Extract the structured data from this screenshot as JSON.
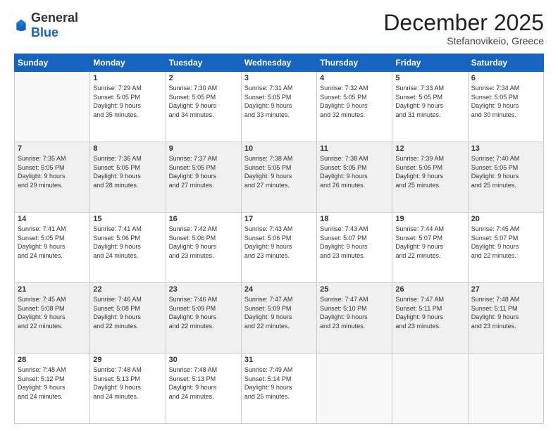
{
  "header": {
    "logo_general": "General",
    "logo_blue": "Blue",
    "month": "December 2025",
    "location": "Stefanovikeio, Greece"
  },
  "days_of_week": [
    "Sunday",
    "Monday",
    "Tuesday",
    "Wednesday",
    "Thursday",
    "Friday",
    "Saturday"
  ],
  "weeks": [
    [
      {
        "day": "",
        "sunrise": "",
        "sunset": "",
        "daylight": ""
      },
      {
        "day": "1",
        "sunrise": "Sunrise: 7:29 AM",
        "sunset": "Sunset: 5:05 PM",
        "daylight": "Daylight: 9 hours and 35 minutes."
      },
      {
        "day": "2",
        "sunrise": "Sunrise: 7:30 AM",
        "sunset": "Sunset: 5:05 PM",
        "daylight": "Daylight: 9 hours and 34 minutes."
      },
      {
        "day": "3",
        "sunrise": "Sunrise: 7:31 AM",
        "sunset": "Sunset: 5:05 PM",
        "daylight": "Daylight: 9 hours and 33 minutes."
      },
      {
        "day": "4",
        "sunrise": "Sunrise: 7:32 AM",
        "sunset": "Sunset: 5:05 PM",
        "daylight": "Daylight: 9 hours and 32 minutes."
      },
      {
        "day": "5",
        "sunrise": "Sunrise: 7:33 AM",
        "sunset": "Sunset: 5:05 PM",
        "daylight": "Daylight: 9 hours and 31 minutes."
      },
      {
        "day": "6",
        "sunrise": "Sunrise: 7:34 AM",
        "sunset": "Sunset: 5:05 PM",
        "daylight": "Daylight: 9 hours and 30 minutes."
      }
    ],
    [
      {
        "day": "7",
        "sunrise": "Sunrise: 7:35 AM",
        "sunset": "Sunset: 5:05 PM",
        "daylight": "Daylight: 9 hours and 29 minutes."
      },
      {
        "day": "8",
        "sunrise": "Sunrise: 7:36 AM",
        "sunset": "Sunset: 5:05 PM",
        "daylight": "Daylight: 9 hours and 28 minutes."
      },
      {
        "day": "9",
        "sunrise": "Sunrise: 7:37 AM",
        "sunset": "Sunset: 5:05 PM",
        "daylight": "Daylight: 9 hours and 27 minutes."
      },
      {
        "day": "10",
        "sunrise": "Sunrise: 7:38 AM",
        "sunset": "Sunset: 5:05 PM",
        "daylight": "Daylight: 9 hours and 27 minutes."
      },
      {
        "day": "11",
        "sunrise": "Sunrise: 7:38 AM",
        "sunset": "Sunset: 5:05 PM",
        "daylight": "Daylight: 9 hours and 26 minutes."
      },
      {
        "day": "12",
        "sunrise": "Sunrise: 7:39 AM",
        "sunset": "Sunset: 5:05 PM",
        "daylight": "Daylight: 9 hours and 25 minutes."
      },
      {
        "day": "13",
        "sunrise": "Sunrise: 7:40 AM",
        "sunset": "Sunset: 5:05 PM",
        "daylight": "Daylight: 9 hours and 25 minutes."
      }
    ],
    [
      {
        "day": "14",
        "sunrise": "Sunrise: 7:41 AM",
        "sunset": "Sunset: 5:05 PM",
        "daylight": "Daylight: 9 hours and 24 minutes."
      },
      {
        "day": "15",
        "sunrise": "Sunrise: 7:41 AM",
        "sunset": "Sunset: 5:06 PM",
        "daylight": "Daylight: 9 hours and 24 minutes."
      },
      {
        "day": "16",
        "sunrise": "Sunrise: 7:42 AM",
        "sunset": "Sunset: 5:06 PM",
        "daylight": "Daylight: 9 hours and 23 minutes."
      },
      {
        "day": "17",
        "sunrise": "Sunrise: 7:43 AM",
        "sunset": "Sunset: 5:06 PM",
        "daylight": "Daylight: 9 hours and 23 minutes."
      },
      {
        "day": "18",
        "sunrise": "Sunrise: 7:43 AM",
        "sunset": "Sunset: 5:07 PM",
        "daylight": "Daylight: 9 hours and 23 minutes."
      },
      {
        "day": "19",
        "sunrise": "Sunrise: 7:44 AM",
        "sunset": "Sunset: 5:07 PM",
        "daylight": "Daylight: 9 hours and 22 minutes."
      },
      {
        "day": "20",
        "sunrise": "Sunrise: 7:45 AM",
        "sunset": "Sunset: 5:07 PM",
        "daylight": "Daylight: 9 hours and 22 minutes."
      }
    ],
    [
      {
        "day": "21",
        "sunrise": "Sunrise: 7:45 AM",
        "sunset": "Sunset: 5:08 PM",
        "daylight": "Daylight: 9 hours and 22 minutes."
      },
      {
        "day": "22",
        "sunrise": "Sunrise: 7:46 AM",
        "sunset": "Sunset: 5:08 PM",
        "daylight": "Daylight: 9 hours and 22 minutes."
      },
      {
        "day": "23",
        "sunrise": "Sunrise: 7:46 AM",
        "sunset": "Sunset: 5:09 PM",
        "daylight": "Daylight: 9 hours and 22 minutes."
      },
      {
        "day": "24",
        "sunrise": "Sunrise: 7:47 AM",
        "sunset": "Sunset: 5:09 PM",
        "daylight": "Daylight: 9 hours and 22 minutes."
      },
      {
        "day": "25",
        "sunrise": "Sunrise: 7:47 AM",
        "sunset": "Sunset: 5:10 PM",
        "daylight": "Daylight: 9 hours and 23 minutes."
      },
      {
        "day": "26",
        "sunrise": "Sunrise: 7:47 AM",
        "sunset": "Sunset: 5:11 PM",
        "daylight": "Daylight: 9 hours and 23 minutes."
      },
      {
        "day": "27",
        "sunrise": "Sunrise: 7:48 AM",
        "sunset": "Sunset: 5:11 PM",
        "daylight": "Daylight: 9 hours and 23 minutes."
      }
    ],
    [
      {
        "day": "28",
        "sunrise": "Sunrise: 7:48 AM",
        "sunset": "Sunset: 5:12 PM",
        "daylight": "Daylight: 9 hours and 24 minutes."
      },
      {
        "day": "29",
        "sunrise": "Sunrise: 7:48 AM",
        "sunset": "Sunset: 5:13 PM",
        "daylight": "Daylight: 9 hours and 24 minutes."
      },
      {
        "day": "30",
        "sunrise": "Sunrise: 7:48 AM",
        "sunset": "Sunset: 5:13 PM",
        "daylight": "Daylight: 9 hours and 24 minutes."
      },
      {
        "day": "31",
        "sunrise": "Sunrise: 7:49 AM",
        "sunset": "Sunset: 5:14 PM",
        "daylight": "Daylight: 9 hours and 25 minutes."
      },
      {
        "day": "",
        "sunrise": "",
        "sunset": "",
        "daylight": ""
      },
      {
        "day": "",
        "sunrise": "",
        "sunset": "",
        "daylight": ""
      },
      {
        "day": "",
        "sunrise": "",
        "sunset": "",
        "daylight": ""
      }
    ]
  ]
}
